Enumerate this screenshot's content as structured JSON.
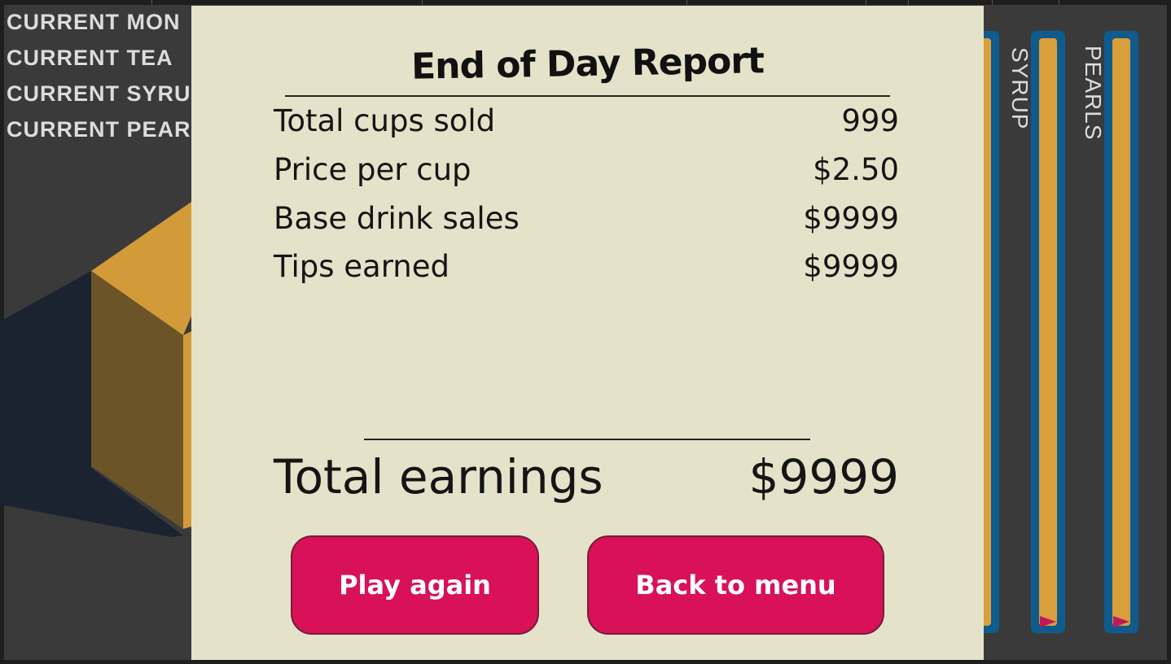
{
  "hud": {
    "lines": [
      "CURRENT MON",
      "CURRENT TEA",
      "CURRENT SYRU",
      "CURRENT PEAR"
    ]
  },
  "resource_bars": [
    {
      "label": "",
      "fill_fraction": 1.0
    },
    {
      "label": "SYRUP",
      "fill_fraction": 1.0
    },
    {
      "label": "PEARLS",
      "fill_fraction": 1.0
    }
  ],
  "report": {
    "title": "End of Day Report",
    "rows": [
      {
        "label": "Total cups sold",
        "value": "999"
      },
      {
        "label": "Price per cup",
        "value": "$2.50"
      },
      {
        "label": "Base drink sales",
        "value": "$9999"
      },
      {
        "label": "Tips earned",
        "value": "$9999"
      }
    ],
    "total": {
      "label": "Total earnings",
      "value": "$9999"
    },
    "buttons": {
      "play_again": "Play again",
      "back_to_menu": "Back to menu"
    }
  },
  "colors": {
    "panel": "#e4e3c9",
    "button": "#d81159",
    "bar_border": "#0f5b8d",
    "bar_fill": "#d99f3a",
    "box_top": "#d39a3a",
    "box_side": "#6b5528",
    "shadow": "#1b2230",
    "background": "#3a3a3a"
  }
}
